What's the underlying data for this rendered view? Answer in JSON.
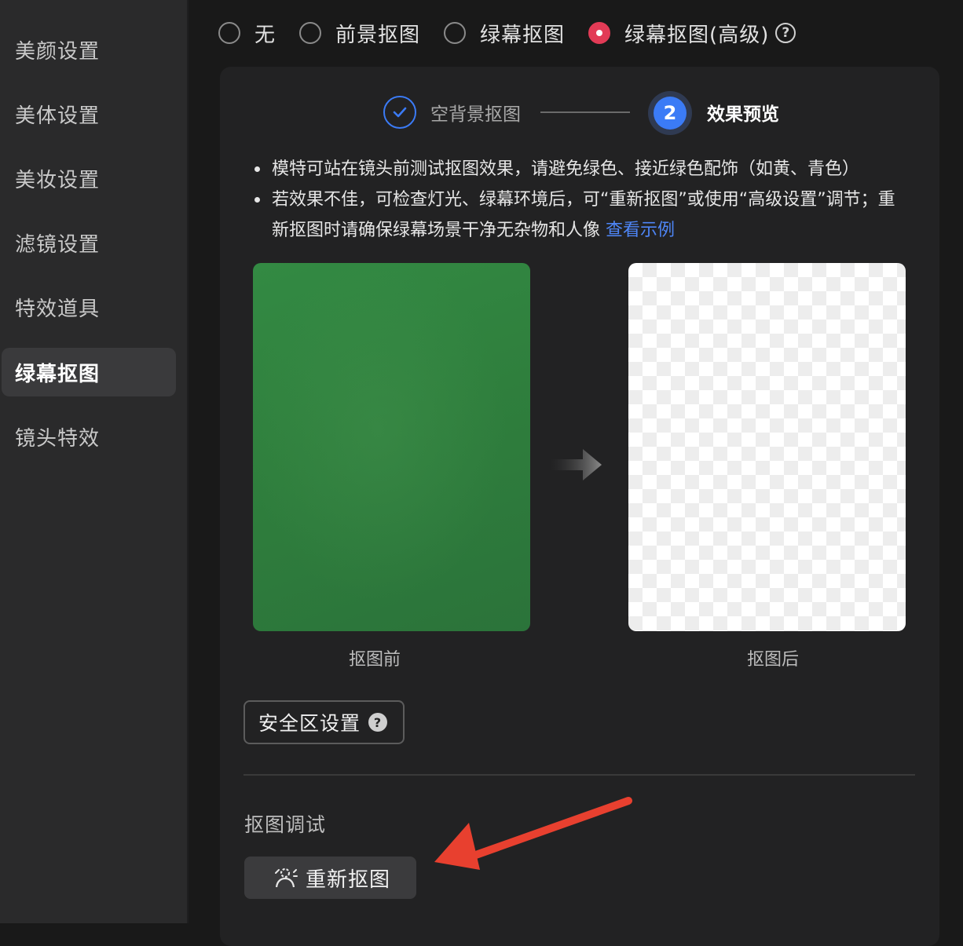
{
  "sidebar": {
    "items": [
      {
        "label": "美颜设置"
      },
      {
        "label": "美体设置"
      },
      {
        "label": "美妆设置"
      },
      {
        "label": "滤镜设置"
      },
      {
        "label": "特效道具"
      },
      {
        "label": "绿幕抠图"
      },
      {
        "label": "镜头特效"
      }
    ],
    "active_item": "绿幕抠图"
  },
  "mode_options": {
    "items": [
      {
        "label": "无",
        "checked": false
      },
      {
        "label": "前景抠图",
        "checked": false
      },
      {
        "label": "绿幕抠图",
        "checked": false
      },
      {
        "label": "绿幕抠图(高级)",
        "checked": true
      }
    ],
    "help_icon": "question-circle-icon",
    "help_glyph": "?"
  },
  "steps": {
    "step1": {
      "label": "空背景抠图",
      "status": "done",
      "icon": "check-icon"
    },
    "step2": {
      "number": "2",
      "label": "效果预览",
      "status": "active"
    }
  },
  "tips": {
    "line1": "模特可站在镜头前测试抠图效果，请避免绿色、接近绿色配饰（如黄、青色）",
    "line2": "若效果不佳，可检查灯光、绿幕环境后，可“重新抠图”或使用“高级设置”调节；重新抠图时请确保绿幕场景干净无杂物和人像",
    "link": "查看示例"
  },
  "preview": {
    "before_caption": "抠图前",
    "after_caption": "抠图后",
    "arrow_icon": "arrow-right-icon"
  },
  "safe_zone": {
    "label": "安全区设置",
    "help_glyph": "?"
  },
  "debug": {
    "title": "抠图调试",
    "redo_label": "重新抠图",
    "redo_icon": "rematte-icon"
  },
  "colors": {
    "accent_blue": "#3b7bf6",
    "radio_checked": "#e23b56",
    "link": "#4e86f7",
    "annotation_arrow": "#e8402f"
  }
}
